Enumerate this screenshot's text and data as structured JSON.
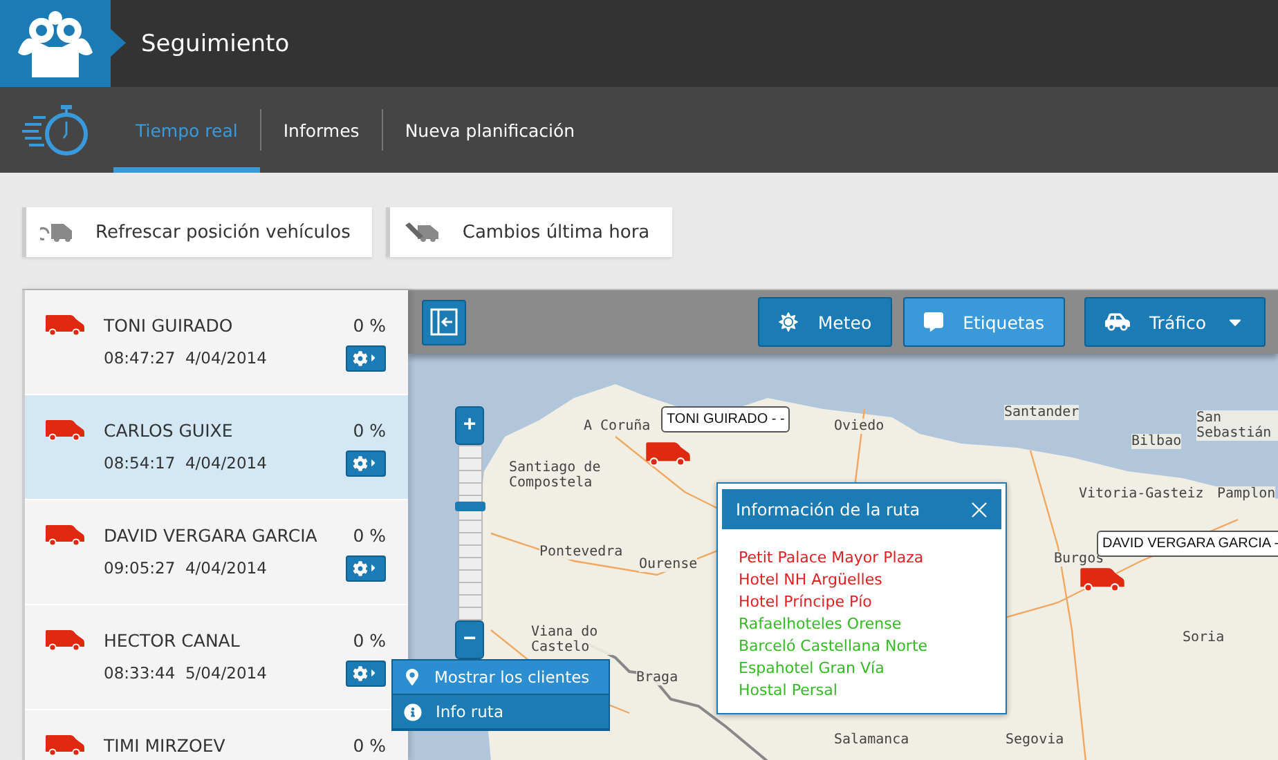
{
  "app": {
    "title": "Seguimiento"
  },
  "tabs": [
    {
      "label": "Tiempo real",
      "selected": true
    },
    {
      "label": "Informes",
      "selected": false
    },
    {
      "label": "Nueva planificación",
      "selected": false
    }
  ],
  "actions": [
    {
      "label": "Refrescar posición vehículos",
      "kind": "refresh"
    },
    {
      "label": "Cambios última hora",
      "kind": "changes"
    }
  ],
  "vehicles": [
    {
      "name": "TONI GUIRADO",
      "percent": "0 %",
      "time": "08:47:27",
      "date": "4/04/2014",
      "selected": false
    },
    {
      "name": "CARLOS GUIXE",
      "percent": "0 %",
      "time": "08:54:17",
      "date": "4/04/2014",
      "selected": true
    },
    {
      "name": "DAVID VERGARA GARCIA",
      "percent": "0 %",
      "time": "09:05:27",
      "date": "4/04/2014",
      "selected": false
    },
    {
      "name": "HECTOR CANAL",
      "percent": "0 %",
      "time": "08:33:44",
      "date": "5/04/2014",
      "selected": false
    },
    {
      "name": "TIMI MIRZOEV",
      "percent": "0 %",
      "selected": false
    }
  ],
  "vehicle_menu": {
    "items": [
      {
        "label": "Mostrar los clientes",
        "kind": "pin",
        "selected": true
      },
      {
        "label": "Info ruta",
        "kind": "info",
        "selected": false
      }
    ]
  },
  "map_toolbar": {
    "buttons": [
      {
        "label": "Meteo",
        "kind": "weather",
        "selected": false
      },
      {
        "label": "Etiquetas",
        "kind": "labels",
        "selected": true
      },
      {
        "label": "Tráfico",
        "kind": "traffic",
        "selected": false
      }
    ]
  },
  "zoom": {
    "level": 0.66,
    "in_label": "+",
    "out_label": "−"
  },
  "map": {
    "places": [
      {
        "name": "A Coruña"
      },
      {
        "name": "Santiago de Compostela"
      },
      {
        "name": "Pontevedra"
      },
      {
        "name": "Viana do Castelo"
      },
      {
        "name": "Ourense"
      },
      {
        "name": "Braga"
      },
      {
        "name": "Oviedo"
      },
      {
        "name": "Santander"
      },
      {
        "name": "Bilbao"
      },
      {
        "name": "San Sebastián"
      },
      {
        "name": "Vitoria-Gasteiz"
      },
      {
        "name": "Pamplon"
      },
      {
        "name": "Burgos"
      },
      {
        "name": "Soria"
      },
      {
        "name": "Salamanca"
      },
      {
        "name": "Segovia"
      }
    ],
    "markers": [
      {
        "label": "TONI GUIRADO - -"
      },
      {
        "label": "DAVID VERGARA GARCIA -"
      }
    ]
  },
  "route_info": {
    "title": "Información de la ruta",
    "stops": [
      {
        "name": "Petit Palace Mayor Plaza",
        "color": "#e02020"
      },
      {
        "name": "Hotel NH Argüelles",
        "color": "#e02020"
      },
      {
        "name": "Hotel Príncipe Pío",
        "color": "#e02020"
      },
      {
        "name": "Rafaelhoteles Orense",
        "color": "#33bb22"
      },
      {
        "name": "Barceló Castellana Norte",
        "color": "#33bb22"
      },
      {
        "name": "Espahotel Gran Vía",
        "color": "#33bb22"
      },
      {
        "name": "Hostal Persal",
        "color": "#33bb22"
      }
    ]
  }
}
